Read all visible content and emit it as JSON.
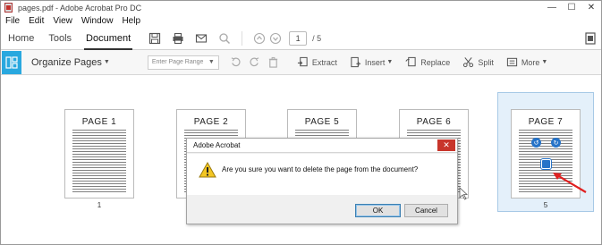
{
  "window": {
    "title": "pages.pdf - Adobe Acrobat Pro DC",
    "minimize": "—",
    "maximize": "☐",
    "close": "✕"
  },
  "menu": [
    "File",
    "Edit",
    "View",
    "Window",
    "Help"
  ],
  "tabs": [
    "Home",
    "Tools",
    "Document"
  ],
  "toolbar": {
    "current_page": "1",
    "total_pages": "/ 5"
  },
  "organize": {
    "title": "Organize Pages",
    "range_placeholder": "Enter Page Range",
    "tools": {
      "extract": "Extract",
      "insert": "Insert",
      "replace": "Replace",
      "split": "Split",
      "more": "More"
    }
  },
  "thumbnails": [
    {
      "label": "PAGE 1",
      "number": "1"
    },
    {
      "label": "PAGE 2",
      "number": ""
    },
    {
      "label": "PAGE 5",
      "number": ""
    },
    {
      "label": "PAGE 6",
      "number": ""
    },
    {
      "label": "PAGE 7",
      "number": "5"
    }
  ],
  "dialog": {
    "title": "Adobe Acrobat",
    "message": "Are you sure you want to delete the page from the document?",
    "ok": "OK",
    "cancel": "Cancel",
    "close": "✕"
  },
  "colors": {
    "accent": "#29a8df",
    "selection": "#e4f0fa",
    "close_red": "#c8352b",
    "arrow_red": "#e02020",
    "page_tool_blue": "#2673c8"
  }
}
